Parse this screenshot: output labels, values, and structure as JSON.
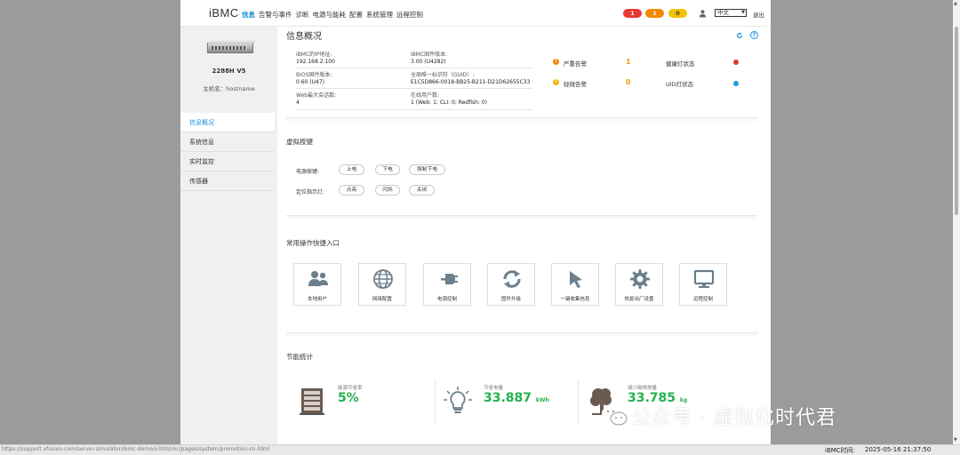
{
  "header": {
    "logo": "iBMC",
    "nav": [
      "信息",
      "告警与事件",
      "诊断",
      "电源与能耗",
      "配置",
      "系统管理",
      "远程控制"
    ],
    "alarm_counts": {
      "critical": "1",
      "major": "1",
      "minor": "0"
    },
    "language": "中文",
    "logout": "退出"
  },
  "sidebar": {
    "model": "2288H V5",
    "hostname": "主机名：hostname",
    "items": [
      "信息概况",
      "系统信息",
      "实时监控",
      "传感器"
    ]
  },
  "page": {
    "title": "信息概况"
  },
  "info": {
    "ip_label": "iBMC的IP地址:",
    "ip_value": "192.168.2.100",
    "fw_label": "iBMC固件版本:",
    "fw_value": "3.00 (U4282)",
    "bios_label": "BIOS固件版本:",
    "bios_value": "0.60 (U47)",
    "guid_label": "全局唯一标识符（GUID）:",
    "guid_value": "E1C5D866-0018-BB25-B211-D21D62655C33",
    "web_label": "Web最大会话数:",
    "web_value": "4",
    "online_label": "在线用户数:",
    "online_value": "1 (Web: 1; CLI: 0; Redfish: 0)"
  },
  "alarms": {
    "critical_label": "严重告警",
    "critical_count": "1",
    "minor_label": "轻微告警",
    "minor_count": "0",
    "health_label": "健康灯状态",
    "uid_label": "UID灯状态",
    "health_color": "#e53935",
    "uid_color": "#1a9ae0"
  },
  "virtual_buttons": {
    "title": "虚拟按键",
    "power_label": "电源按键:",
    "power_buttons": [
      "上电",
      "下电",
      "强制下电"
    ],
    "uid_label": "定位指示灯:",
    "uid_buttons": [
      "点亮",
      "闪烁",
      "关闭"
    ]
  },
  "quick_actions": {
    "title": "常用操作快捷入口",
    "items": [
      {
        "label": "本地用户",
        "icon": "users-icon"
      },
      {
        "label": "网络配置",
        "icon": "globe-icon"
      },
      {
        "label": "电源控制",
        "icon": "plug-icon"
      },
      {
        "label": "固件升级",
        "icon": "refresh-icon"
      },
      {
        "label": "一键收集信息",
        "icon": "cursor-icon"
      },
      {
        "label": "恢复出厂设置",
        "icon": "gear-icon"
      },
      {
        "label": "远程控制",
        "icon": "monitor-icon"
      }
    ]
  },
  "energy": {
    "title": "节能统计",
    "rate_label": "能源节省率",
    "rate_value": "5%",
    "power_label": "节省电量",
    "power_value": "33.887",
    "power_unit": "kWh",
    "co2_label": "减少碳排放量",
    "co2_value": "33.785",
    "co2_unit": "kg"
  },
  "watermark": "公众号 · 虚拟化时代君",
  "status_bar": {
    "url": "https://support.xfusion.com/server-simulator/ibmc-demo/v300/imc/pages/system/promotion-cn.html",
    "time_label": "iBMC时间:",
    "time_value": "2025-05-16 21:37:50"
  }
}
